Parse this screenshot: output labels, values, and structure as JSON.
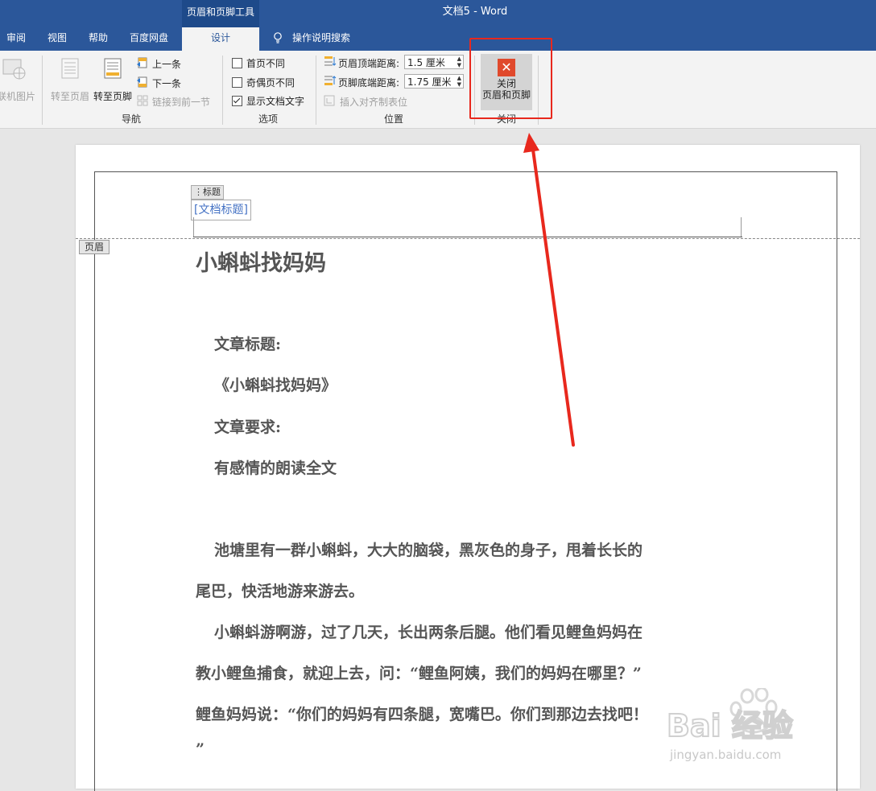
{
  "window": {
    "title": "文档5  -  Word",
    "context_tools": "页眉和页脚工具"
  },
  "tabs": [
    {
      "label": "审阅"
    },
    {
      "label": "视图"
    },
    {
      "label": "帮助"
    },
    {
      "label": "百度网盘"
    },
    {
      "label": "设计",
      "active": true
    },
    {
      "label": "操作说明搜索"
    }
  ],
  "ribbon": {
    "insert": {
      "online_picture": "联机图片"
    },
    "nav": {
      "goto_header": "转至页眉",
      "goto_footer": "转至页脚",
      "prev": "上一条",
      "next": "下一条",
      "link_prev": "链接到前一节",
      "group": "导航"
    },
    "options": {
      "first_page": "首页不同",
      "odd_even": "奇偶页不同",
      "show_doc_text": "显示文档文字",
      "group": "选项",
      "checked": [
        false,
        false,
        true
      ]
    },
    "position": {
      "header_top_label": "页眉顶端距离:",
      "header_top_value": "1.5 厘米",
      "footer_bottom_label": "页脚底端距离:",
      "footer_bottom_value": "1.75 厘米",
      "insert_align_tab": "插入对齐制表位",
      "group": "位置"
    },
    "close": {
      "label_line1": "关闭",
      "label_line2": "页眉和页脚",
      "group": "关闭"
    }
  },
  "document": {
    "header_cc_tag": "标题",
    "header_cc_placeholder": "[文档标题]",
    "header_tag": "页眉",
    "heading": "小蝌蚪找妈妈",
    "lines": [
      "文章标题:",
      "《小蝌蚪找妈妈》",
      "文章要求:",
      "有感情的朗读全文",
      "池塘里有一群小蝌蚪，大大的脑袋，黑灰色的身子，甩着长长的",
      "尾巴，快活地游来游去。",
      "小蝌蚪游啊游，过了几天，长出两条后腿。他们看见鲤鱼妈妈在",
      "教小鲤鱼捕食，就迎上去，问：“鲤鱼阿姨，我们的妈妈在哪里？”",
      "鲤鱼妈妈说：“你们的妈妈有四条腿，宽嘴巴。你们到那边去找吧！",
      "”"
    ]
  },
  "watermark": {
    "brand": "Bai 经验",
    "url": "jingyan.baidu.com"
  },
  "colors": {
    "titlebar": "#2b579a",
    "annotation": "#e8281d",
    "close_icon": "#e0492c"
  }
}
